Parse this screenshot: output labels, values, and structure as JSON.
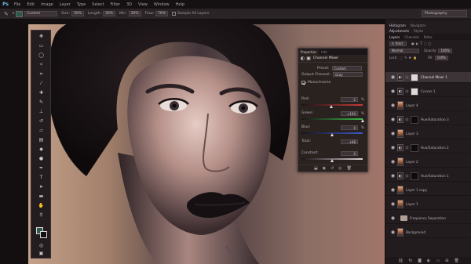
{
  "app": {
    "logo": "Ps"
  },
  "menu": [
    "File",
    "Edit",
    "Image",
    "Layer",
    "Type",
    "Select",
    "Filter",
    "3D",
    "View",
    "Window",
    "Help"
  ],
  "options": {
    "tool_icon": "brush-tool-icon",
    "preset": "Custom",
    "mode_label": "Mode:",
    "size_label": "Size:",
    "size_value": "30%",
    "length_label": "Length:",
    "length_value": "30%",
    "min_label": "Min:",
    "min_value": "30%",
    "flow_label": "Flow:",
    "flow_value": "70%",
    "sample_all_layers": "Sample All Layers",
    "workspace": "Photography",
    "fg_color": "#2c5b4a"
  },
  "properties": {
    "tabs": [
      "Properties",
      "Info"
    ],
    "title": "Channel Mixer",
    "preset_label": "Preset:",
    "preset_value": "Custom",
    "output_label": "Output Channel:",
    "output_value": "Gray",
    "monochrome_label": "Monochrome",
    "sliders": [
      {
        "label": "Red:",
        "value": "-2",
        "fraction": 0.49,
        "color": "#c83a3a"
      },
      {
        "label": "Green:",
        "value": "+100",
        "fraction": 1.0,
        "color": "#3ab84a"
      },
      {
        "label": "Blue:",
        "value": "0",
        "fraction": 0.5,
        "color": "#3a58d0"
      },
      {
        "label": "Total:",
        "value": "+98",
        "fraction": 0.9,
        "color": "#55494e"
      },
      {
        "label": "Constant:",
        "value": "0",
        "fraction": 0.5,
        "color": "#d8d0d4"
      }
    ],
    "percent": "%"
  },
  "panels": {
    "top_tabs": [
      "Histogram",
      "Navigator"
    ],
    "adjust_tabs": [
      "Adjustments",
      "Styles"
    ],
    "layer_tabs": [
      "Layers",
      "Channels",
      "Paths"
    ],
    "kind_label": "Kind",
    "blend_mode": "Normal",
    "opacity_label": "Opacity:",
    "opacity_value": "100%",
    "lock_label": "Lock:",
    "fill_label": "Fill:",
    "fill_value": "100%"
  },
  "layers": [
    {
      "name": "Channel Mixer 1",
      "kind": "adjust",
      "mask": "white",
      "selected": true
    },
    {
      "name": "Curves 1",
      "kind": "adjust",
      "mask": "white",
      "selected": false
    },
    {
      "name": "Layer 4",
      "kind": "person",
      "mask": "none",
      "selected": false
    },
    {
      "name": "Hue/Saturation 3",
      "kind": "adjust",
      "mask": "dark",
      "selected": false
    },
    {
      "name": "Layer 3",
      "kind": "person",
      "mask": "none",
      "selected": false
    },
    {
      "name": "Hue/Saturation 2",
      "kind": "adjust",
      "mask": "dark",
      "selected": false
    },
    {
      "name": "Layer 2",
      "kind": "person",
      "mask": "none",
      "selected": false
    },
    {
      "name": "Hue/Saturation 1",
      "kind": "adjust",
      "mask": "dark",
      "selected": false
    },
    {
      "name": "Layer 1 copy",
      "kind": "person",
      "mask": "none",
      "selected": false
    },
    {
      "name": "Layer 1",
      "kind": "person",
      "mask": "none",
      "selected": false
    },
    {
      "name": "Frequency Separation",
      "kind": "folder",
      "mask": "none",
      "selected": false
    },
    {
      "name": "Background",
      "kind": "person",
      "mask": "none",
      "selected": false
    }
  ]
}
